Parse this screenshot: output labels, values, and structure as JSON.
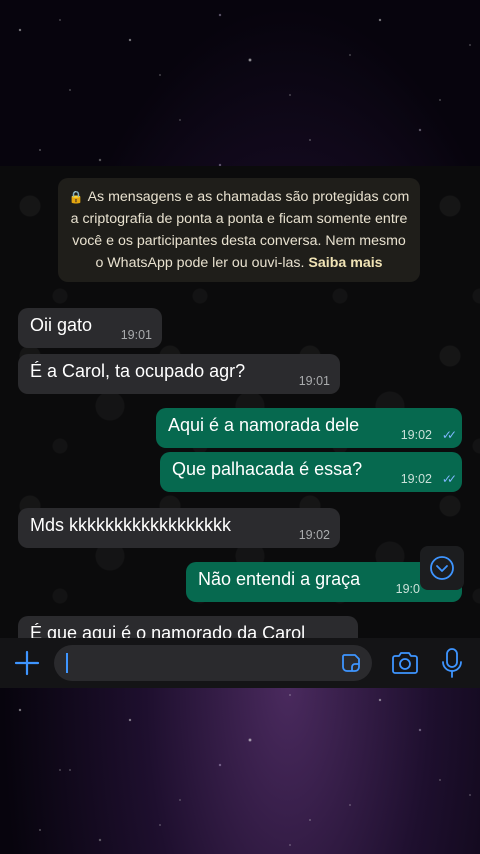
{
  "encryption_notice": {
    "text": "As mensagens e as chamadas são protegidas com a criptografia de ponta a ponta e ficam somente entre você e os participantes desta conversa. Nem mesmo o WhatsApp pode ler ou ouvi-las.",
    "learn_more": "Saiba mais"
  },
  "messages": [
    {
      "direction": "in",
      "text": "Oii gato",
      "time": "19:01"
    },
    {
      "direction": "in",
      "text": "É a Carol, ta ocupado agr?",
      "time": "19:01"
    },
    {
      "direction": "out",
      "text": "Aqui é a namorada dele",
      "time": "19:02",
      "ticks": "✓✓"
    },
    {
      "direction": "out",
      "text": "Que palhacada é essa?",
      "time": "19:02",
      "ticks": "✓✓"
    },
    {
      "direction": "in",
      "text": "Mds kkkkkkkkkkkkkkkkkk",
      "time": "19:02"
    },
    {
      "direction": "out",
      "text": "Não entendi a graça",
      "time": "19:0"
    },
    {
      "direction": "in",
      "text": "É que aqui é o namorado da Carol",
      "time": ""
    }
  ],
  "icons": {
    "lock": "lock-icon",
    "scroll_down": "chevron-down-circle-icon",
    "plus": "plus-icon",
    "sticker": "sticker-icon",
    "camera": "camera-icon",
    "mic": "microphone-icon"
  },
  "colors": {
    "incoming_bubble": "#2b2b2e",
    "outgoing_bubble": "#06694f",
    "accent": "#3e95ff",
    "read_ticks": "#7fb7ff"
  }
}
